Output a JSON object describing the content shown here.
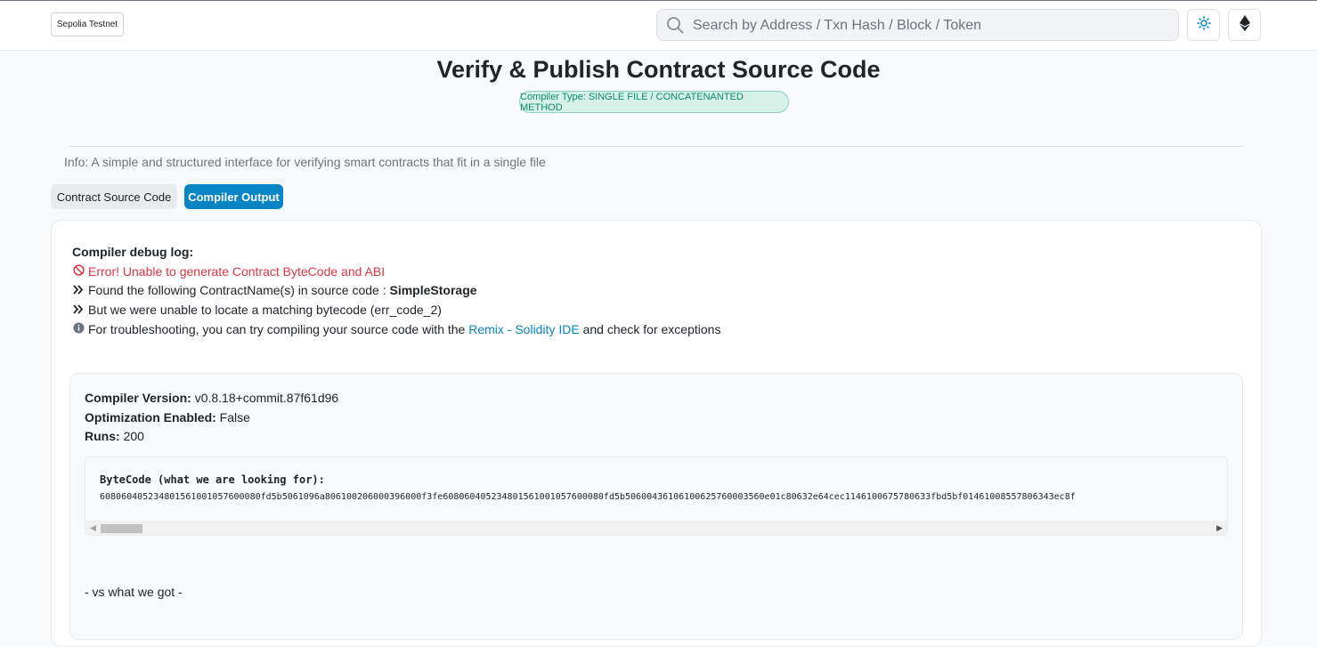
{
  "header": {
    "network_label": "Sepolia Testnet",
    "search_placeholder": "Search by Address / Txn Hash / Block / Token"
  },
  "page": {
    "title": "Verify & Publish Contract Source Code",
    "compiler_badge": "Compiler Type: SINGLE FILE / CONCATENANTED METHOD",
    "info": "Info: A simple and structured interface for verifying smart contracts that fit in a single file"
  },
  "tabs": [
    {
      "label": "Contract Source Code",
      "active": false
    },
    {
      "label": "Compiler Output",
      "active": true
    }
  ],
  "debug_log": {
    "title": "Compiler debug log:",
    "error": "Error! Unable to generate Contract ByteCode and ABI",
    "line1_prefix": "Found the following ContractName(s) in source code : ",
    "line1_name": "SimpleStorage",
    "line2": "But we were unable to locate a matching bytecode (err_code_2)",
    "line3_prefix": "For troubleshooting, you can try compiling your source code with the ",
    "line3_link": "Remix - Solidity IDE",
    "line3_suffix": " and check for exceptions"
  },
  "compiler_info": {
    "version_label": "Compiler Version:",
    "version_value": "v0.8.18+commit.87f61d96",
    "optimization_label": "Optimization Enabled:",
    "optimization_value": "False",
    "runs_label": "Runs:",
    "runs_value": "200"
  },
  "bytecode": {
    "label": "ByteCode (what we are looking for):",
    "value": "608060405234801561001057600080fd5b5061096a806100206000396000f3fe608060405234801561001057600080fd5b50600436106100625760003560e01c80632e64cec1146100675780633fbd5bf01461008557806343ec8f"
  },
  "vs_text": "- vs what we got -",
  "colors": {
    "accent": "#0784c3",
    "error": "#dc3545",
    "badge_green": "#0f8a69"
  }
}
